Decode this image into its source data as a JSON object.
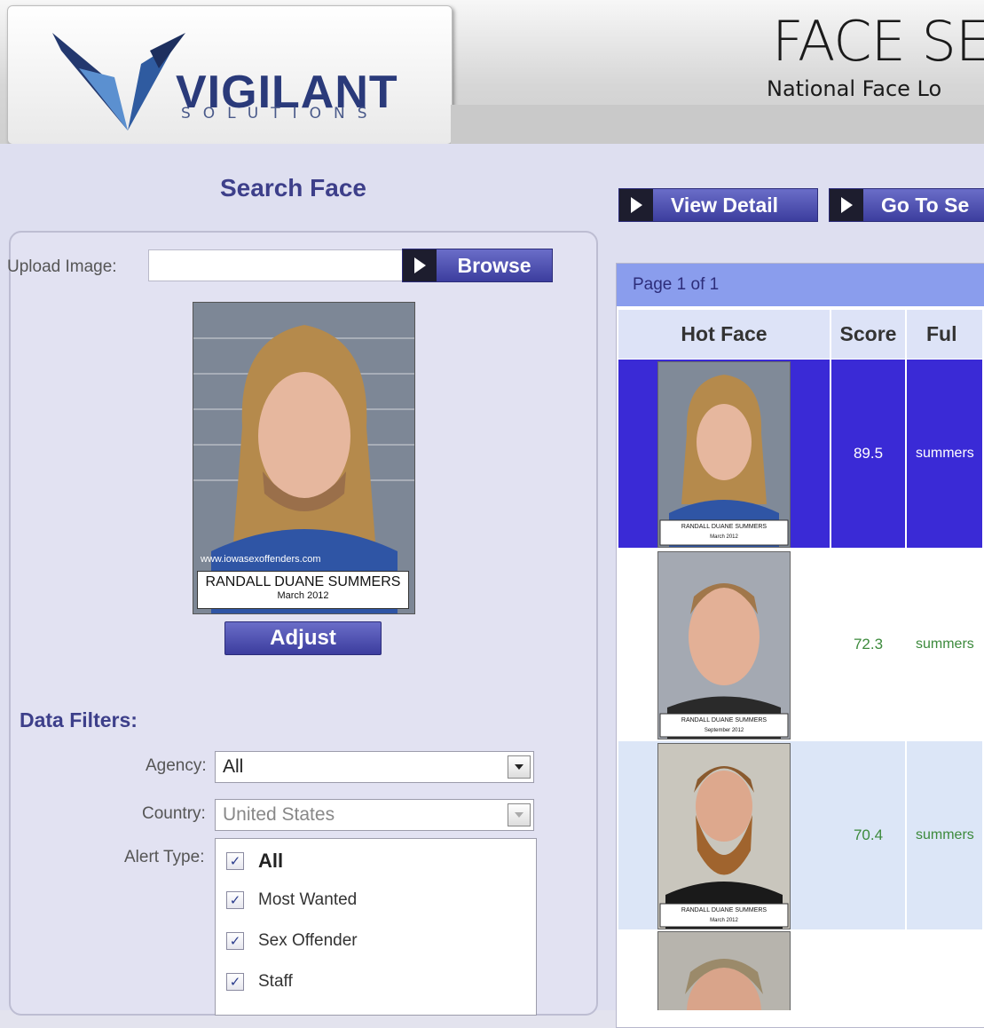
{
  "header": {
    "logo_name": "VIGILANT",
    "logo_tagline": "SOLUTIONS",
    "app_title": "FACE SE",
    "app_subtitle": "National Face Lo"
  },
  "search": {
    "title": "Search Face",
    "upload_label": "Upload Image:",
    "upload_value": "",
    "browse_label": "Browse",
    "photo": {
      "website": "www.iowasexoffenders.com",
      "name": "RANDALL DUANE SUMMERS",
      "date": "March 2012"
    },
    "adjust_label": "Adjust"
  },
  "filters": {
    "title": "Data Filters:",
    "agency_label": "Agency:",
    "agency_value": "All",
    "country_label": "Country:",
    "country_value": "United States",
    "alert_label": "Alert Type:",
    "alert_options": [
      {
        "label": "All",
        "checked": true
      },
      {
        "label": "Most Wanted",
        "checked": true
      },
      {
        "label": "Sex Offender",
        "checked": true
      },
      {
        "label": "Staff",
        "checked": true
      }
    ]
  },
  "toolbar": {
    "view_detail_label": "View Detail",
    "goto_label": "Go To Se"
  },
  "results": {
    "pager": "Page 1 of 1",
    "columns": [
      "Hot Face",
      "Score",
      "Ful"
    ],
    "rows": [
      {
        "score": "89.5",
        "name": "summers",
        "caption_name": "RANDALL DUANE SUMMERS",
        "caption_date": "March 2012",
        "selected": true
      },
      {
        "score": "72.3",
        "name": "summers",
        "caption_name": "RANDALL DUANE SUMMERS",
        "caption_date": "September 2012",
        "selected": false
      },
      {
        "score": "70.4",
        "name": "summers",
        "caption_name": "RANDALL DUANE SUMMERS",
        "caption_date": "March 2012",
        "selected": false
      },
      {
        "score": "",
        "name": "",
        "caption_name": "",
        "caption_date": "",
        "selected": false
      }
    ]
  },
  "colors": {
    "accent": "#3d3f8a",
    "selected_row": "#3a2ad6",
    "alt_row": "#dce6f7",
    "score_text": "#3c8a3c"
  }
}
